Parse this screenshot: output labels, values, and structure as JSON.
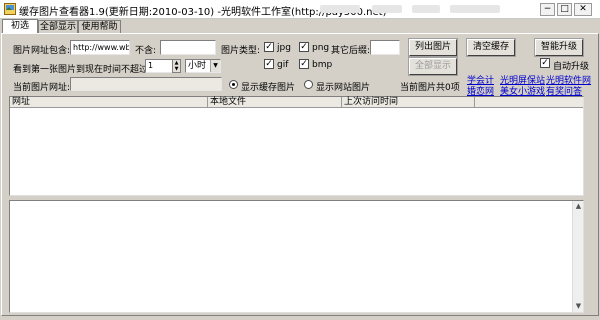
{
  "window": {
    "title": "缓存图片查看器1.9(更新日期:2010-03-10) -光明软件工作室(http://pay500.net)",
    "buttons": {
      "minimize": "−",
      "maximize": "□",
      "close": "✕"
    }
  },
  "tabs": [
    "初选",
    "全部显示",
    "使用帮助"
  ],
  "form": {
    "url_contains_label": "图片网址包含:",
    "url_contains_value": "http://www.wb-s",
    "not_contains_label": "不含:",
    "not_contains_value": "",
    "image_type_label": "图片类型:",
    "types": {
      "jpg": "jpg",
      "png": "png",
      "gif": "gif",
      "bmp": "bmp"
    },
    "other_ext_label": "其它后缀:",
    "other_ext_value": "",
    "time_label": "看到第一张图片到现在时间不超过:",
    "time_value": "1",
    "time_unit": "小时",
    "current_url_label": "当前图片网址:",
    "current_url_value": "",
    "radio_cache": "显示缓存图片",
    "radio_web": "显示网站图片"
  },
  "buttons": {
    "list": "列出图片",
    "clear_cache": "清空缓存",
    "smart_upgrade": "智能升级",
    "show_all": "全部显示"
  },
  "auto_upgrade_label": "自动升级",
  "image_count_label": "当前图片共0项",
  "links": [
    "学会计",
    "光明屏保站",
    "光明软件网",
    "婚恋网",
    "美女小游戏",
    "有奖问答"
  ],
  "list_columns": [
    "网址",
    "本地文件",
    "上次访问时间"
  ],
  "icons": {
    "checkmark": "✓",
    "spin_up": "▲",
    "spin_down": "▼",
    "dropdown": "▼",
    "scroll_up": "▲",
    "scroll_down": "▼"
  }
}
